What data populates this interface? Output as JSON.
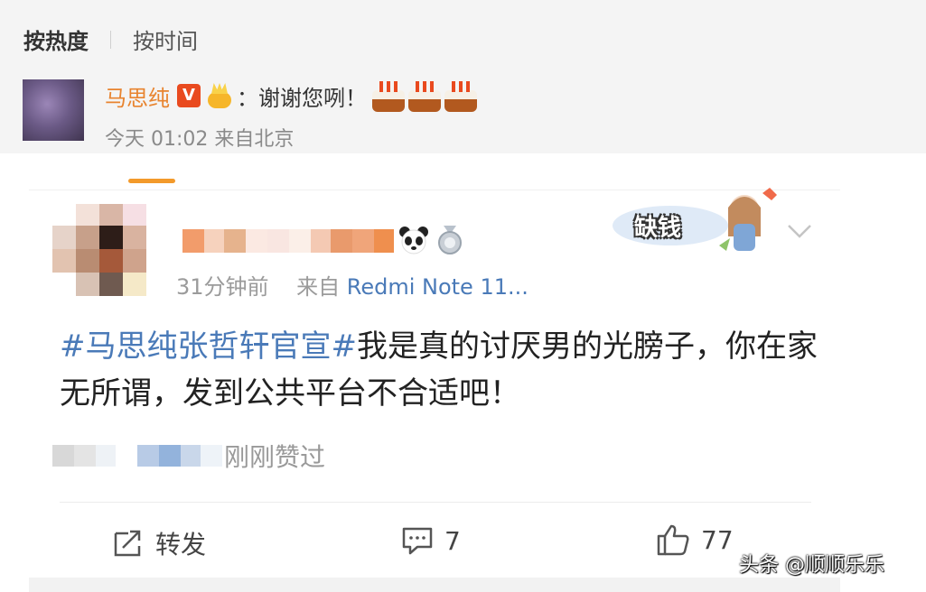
{
  "sort_tabs": {
    "hot": "按热度",
    "time": "按时间"
  },
  "reply": {
    "author": "马思纯",
    "text": "：谢谢您咧！",
    "meta": "今天 01:02 来自北京",
    "icons": [
      "verified-v-icon",
      "crown-icon",
      "cake-icon",
      "cake-icon",
      "cake-icon"
    ]
  },
  "post": {
    "time": "31分钟前",
    "source_prefix": "来自",
    "device": "Redmi Note 11...",
    "hashtag": "#马思纯张哲轩官宣#",
    "content": "我是真的讨厌男的光膀子，你在家无所谓，发到公共平台不合适吧！",
    "liked_text": "刚刚赞过",
    "deco_text": "缺钱"
  },
  "actions": {
    "repost": "转发",
    "comments": "7",
    "likes": "77"
  },
  "watermark": "头条 @顺顺乐乐",
  "colors": {
    "accent": "#f39a2b",
    "link": "#4a7ab8",
    "name": "#e8842f"
  }
}
